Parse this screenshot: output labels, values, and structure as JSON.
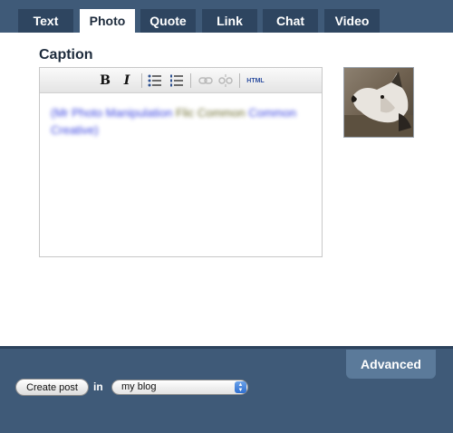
{
  "tabs": {
    "text": "Text",
    "photo": "Photo",
    "quote": "Quote",
    "link": "Link",
    "chat": "Chat",
    "video": "Video",
    "active": "Photo"
  },
  "caption": {
    "label": "Caption",
    "toolbar_icons": [
      "bold-icon",
      "italic-icon",
      "bulleted-list-icon",
      "numbered-list-icon",
      "link-icon",
      "unlink-icon",
      "html-source-icon"
    ],
    "bold_glyph": "B",
    "italic_glyph": "I",
    "html_label": "HTML",
    "blurred_link_text": "(Mr Photo Manipulation",
    "blurred_plain_text": "Flic Common",
    "blurred_link_text_2": "Common Creative)"
  },
  "photo": {
    "thumbnail": "dog-photo-thumbnail"
  },
  "footer": {
    "advanced_label": "Advanced",
    "create_post_label": "Create post",
    "in_label": "in",
    "blog_select_value": "my blog"
  },
  "colors": {
    "background": "#3f5a78",
    "tab_inactive": "#2e4560",
    "tab_active": "#ffffff",
    "advanced_tab": "#5b7a9a"
  }
}
